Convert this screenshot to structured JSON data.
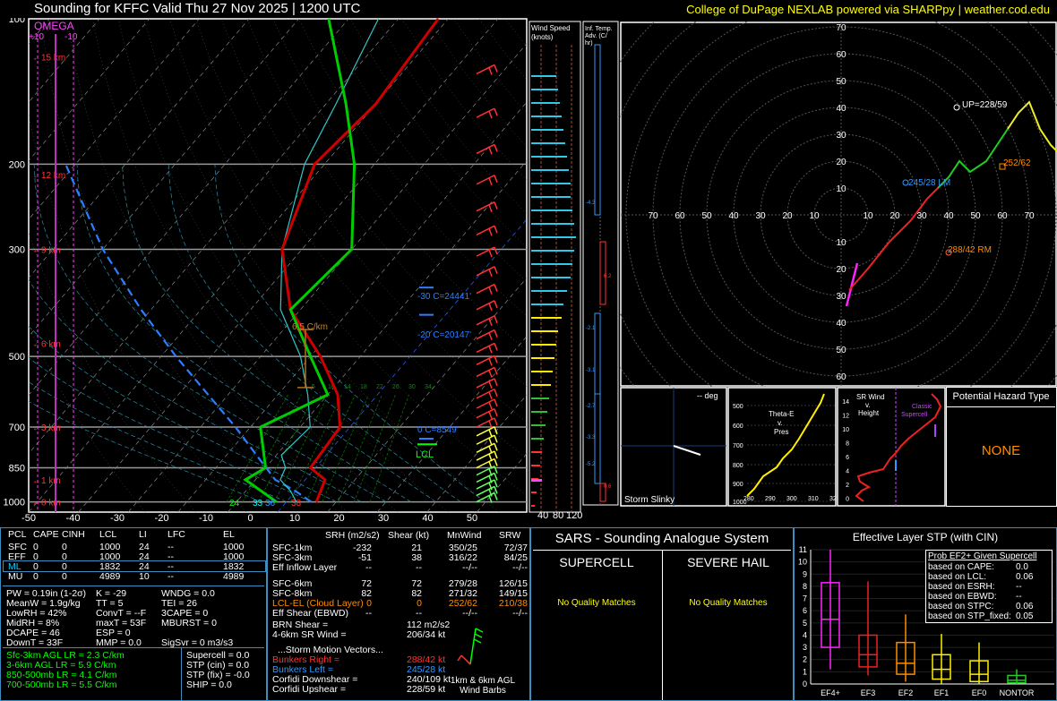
{
  "header": {
    "title": "Sounding for KFFC Valid  Thu 27 Nov 2025 | 1200 UTC",
    "credit": "College of DuPage NEXLAB powered via SHARPpy | weather.cod.edu"
  },
  "skewt": {
    "pressure_ticks": [
      "100",
      "200",
      "300",
      "500",
      "700",
      "850",
      "1000"
    ],
    "temp_ticks": [
      "-50",
      "-40",
      "-30",
      "-20",
      "-10",
      "0",
      "10",
      "20",
      "30",
      "40",
      "50"
    ],
    "height_labels": [
      "15 km",
      "12 km",
      "9 km",
      "6 km",
      "3 km",
      "1 km",
      "0 km"
    ],
    "omega_label": "OMEGA",
    "omega_plus": "+10",
    "omega_minus": "-10",
    "lapse_label": "6.5 C/km",
    "lcl_label": "LCL",
    "isotherm_labels": [
      "-30 C=24441'",
      "-20 C=20147'",
      "0 C=8549'"
    ],
    "mixing_ratio_labels": [
      "6",
      "10",
      "14",
      "18",
      "22",
      "26",
      "30",
      "34"
    ],
    "sfc_td": "24",
    "sfc_tw": "33",
    "sfc_t1": "36",
    "sfc_t2": "38"
  },
  "wind_speed": {
    "title1": "Wind Speed",
    "title2": "(knots)",
    "ticks": [
      "40",
      "80",
      "120"
    ]
  },
  "inferred": {
    "title1": "Inf. Temp.",
    "title2": "Adv. (C/",
    "title3": "hr)",
    "values": [
      "-4.3",
      "6.2",
      "-2.1",
      "-3.1",
      "-2.7",
      "-3.3",
      "-5.2",
      "0.6"
    ]
  },
  "hodograph": {
    "up_label": "UP=228/59",
    "lm_label": "245/28 LM",
    "rm_label": "288/42 RM",
    "mean_label": "252/62",
    "ring_labels": [
      "10",
      "20",
      "30",
      "40",
      "50",
      "60",
      "70"
    ]
  },
  "slinky": {
    "deg": "-- deg",
    "label": "Storm Slinky"
  },
  "thetae": {
    "label1": "Theta-E",
    "label2": "v.",
    "label3": "Pres",
    "p_ticks": [
      "500",
      "600",
      "700",
      "800",
      "900",
      "1000"
    ],
    "x_ticks": [
      "280",
      "290",
      "300",
      "310",
      "32"
    ]
  },
  "srwind": {
    "label1": "SR Wind",
    "label2": "v.",
    "label3": "Height",
    "classic": "Classic",
    "supercell": "Supercell",
    "h_ticks": [
      "14",
      "12",
      "10",
      "8",
      "6",
      "4",
      "2",
      "0"
    ]
  },
  "hazard": {
    "title": "Potential Hazard Type",
    "value": "NONE"
  },
  "parcel_table": {
    "headers": [
      "PCL",
      "CAPE",
      "CINH",
      "LCL",
      "LI",
      "LFC",
      "EL"
    ],
    "rows": [
      [
        "SFC",
        "0",
        "0",
        "1000",
        "24",
        "--",
        "1000"
      ],
      [
        "EFF",
        "0",
        "0",
        "1000",
        "24",
        "--",
        "1000"
      ],
      [
        "ML",
        "0",
        "0",
        "1832",
        "24",
        "--",
        "1832"
      ],
      [
        "MU",
        "0",
        "0",
        "4989",
        "10",
        "--",
        "4989"
      ]
    ]
  },
  "indices": {
    "pw": "PW = 0.19in (1-2σ)",
    "k": "K = -29",
    "wndg": "WNDG = 0.0",
    "meanw": "MeanW = 1.9g/kg",
    "tt": "TT = 5",
    "tei": "TEI = 26",
    "lowrh": "LowRH = 42%",
    "convt": "ConvT = --F",
    "cape3": "3CAPE = 0",
    "midrh": "MidRH = 8%",
    "maxt": "maxT = 53F",
    "mburst": "MBURST = 0",
    "dcape": "DCAPE = 46",
    "esp": "ESP = 0",
    "downt": "DownT = 33F",
    "mmp": "MMP = 0.0",
    "sigsvr": "SigSvr = 0 m3/s3"
  },
  "lapse": {
    "l1": "Sfc-3km AGL LR = 2.3 C/km",
    "l2": "3-6km AGL LR = 5.9 C/km",
    "l3": "850-500mb LR = 4.1 C/km",
    "l4": "700-500mb LR = 5.5 C/km"
  },
  "composite": {
    "supercell": "Supercell = 0.0",
    "stpcin": "STP (cin) = 0.0",
    "stpfix": "STP (fix) = -0.0",
    "ship": "SHIP = 0.0"
  },
  "kinematic": {
    "headers": [
      "SRH (m2/s2)",
      "Shear (kt)",
      "MnWind",
      "SRW"
    ],
    "rows": [
      [
        "SFC-1km",
        "-232",
        "21",
        "350/25",
        "72/37"
      ],
      [
        "SFC-3km",
        "-51",
        "38",
        "316/22",
        "84/25"
      ],
      [
        "Eff Inflow Layer",
        "--",
        "--",
        "--/--",
        "--/--"
      ],
      [
        "SFC-6km",
        "72",
        "72",
        "279/28",
        "126/15"
      ],
      [
        "SFC-8km",
        "82",
        "82",
        "271/32",
        "149/15"
      ],
      [
        "LCL-EL (Cloud Layer)",
        "0",
        "0",
        "252/62",
        "210/38"
      ],
      [
        "Eff Shear (EBWD)",
        "--",
        "--",
        "--/--",
        "--/--"
      ]
    ],
    "brn": "BRN Shear =",
    "brn_val": "112 m2/s2",
    "sr46": "4-6km SR Wind =",
    "sr46_val": "206/34 kt",
    "storm_title": "...Storm Motion Vectors...",
    "br": "Bunkers Right =",
    "br_val": "288/42 kt",
    "bl": "Bunkers Left =",
    "bl_val": "245/28 kt",
    "cdn": "Corfidi Downshear =",
    "cdn_val": "240/109 kt",
    "cup": "Corfidi Upshear =",
    "cup_val": "228/59 kt",
    "barbs1": "1km & 6km AGL",
    "barbs2": "Wind Barbs"
  },
  "sars": {
    "title": "SARS - Sounding Analogue System",
    "supercell": "SUPERCELL",
    "hail": "SEVERE HAIL",
    "nomatch1": "No Quality Matches",
    "nomatch2": "No Quality Matches"
  },
  "stp": {
    "title": "Effective Layer STP (with CIN)",
    "prob_title": "Prob EF2+ Given Supercell",
    "prob_rows": [
      [
        "based on CAPE:",
        "0.0"
      ],
      [
        "based on LCL:",
        "0.06"
      ],
      [
        "based on ESRH:",
        "--"
      ],
      [
        "based on EBWD:",
        "--"
      ],
      [
        "based on STPC:",
        "0.06"
      ],
      [
        "based on STP_fixed:",
        "0.05"
      ]
    ],
    "y_ticks": [
      "0",
      "1",
      "2",
      "3",
      "4",
      "5",
      "6",
      "7",
      "8",
      "9",
      "10",
      "11"
    ],
    "categories": [
      "EF4+",
      "EF3",
      "EF2",
      "EF1",
      "EF0",
      "NONTOR"
    ]
  },
  "colors": {
    "temp": "#cc0000",
    "dewpoint": "#00cc00",
    "parcel": "#2b7fff",
    "panel_border": "#3a8fc0",
    "accent_yellow": "#ffff00",
    "accent_orange": "#ff8c00"
  },
  "chart_data": {
    "type": "line",
    "title": "Sounding for KFFC Valid  Thu 27 Nov 2025 | 1200 UTC",
    "xlabel": "",
    "ylabel": "",
    "ylim": [
      1000,
      100
    ],
    "xlim": [
      -50,
      50
    ],
    "series": [
      {
        "name": "",
        "x": [
          6,
          4,
          -1,
          -2,
          -8,
          -18,
          -32,
          -44,
          -52,
          -50,
          -52
        ],
        "y": [
          1000,
          900,
          850,
          700,
          600,
          500,
          400,
          300,
          200,
          150,
          100
        ]
      },
      {
        "name": "",
        "x": [
          -2,
          -12,
          -10,
          -18,
          -10,
          -20,
          -32,
          -30,
          -44,
          -56,
          -74
        ],
        "y": [
          1000,
          900,
          850,
          700,
          600,
          500,
          400,
          300,
          200,
          150,
          100
        ]
      }
    ],
    "stp_boxes": [
      {
        "category": "EF4+",
        "min": 1.2,
        "q1": 3.0,
        "median": 5.3,
        "q3": 8.3,
        "max": 11.0
      },
      {
        "category": "EF3",
        "min": 0.7,
        "q1": 1.4,
        "median": 2.4,
        "q3": 4.0,
        "max": 8.4
      },
      {
        "category": "EF2",
        "min": 0.2,
        "q1": 0.8,
        "median": 1.7,
        "q3": 3.4,
        "max": 5.7
      },
      {
        "category": "EF1",
        "min": 0.0,
        "q1": 0.4,
        "median": 1.2,
        "q3": 2.4,
        "max": 4.1
      },
      {
        "category": "EF0",
        "min": 0.0,
        "q1": 0.2,
        "median": 0.8,
        "q3": 1.9,
        "max": 3.4
      },
      {
        "category": "NONTOR",
        "min": 0.0,
        "q1": 0.1,
        "median": 0.3,
        "q3": 0.7,
        "max": 1.2
      }
    ]
  }
}
